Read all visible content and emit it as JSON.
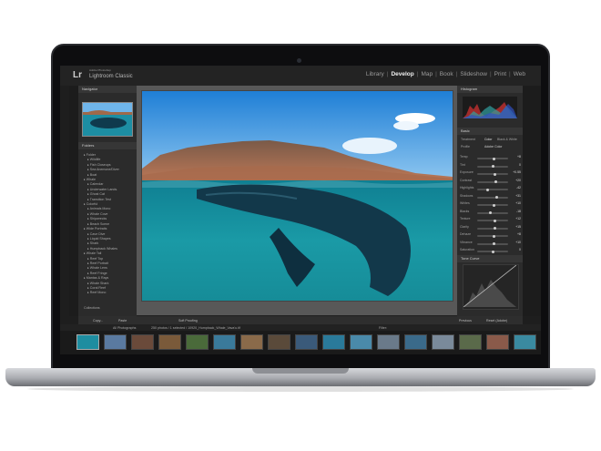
{
  "app": {
    "logo": "Lr",
    "vendor_line": "Adobe Photoshop",
    "product_line": "Lightroom Classic"
  },
  "modules": [
    "Library",
    "Develop",
    "Map",
    "Book",
    "Slideshow",
    "Print",
    "Web"
  ],
  "active_module": "Develop",
  "left_panel": {
    "navigator_title": "Navigator",
    "folders_title": "Folders",
    "tree_items": [
      "Folder",
      "Wildlife",
      "Fish Closeups",
      "Sea Anemone/Diver",
      "Boat",
      "Whale",
      "Calendar",
      "Underwater Lands.",
      "Ghost Cat",
      "Transition Test",
      "Colorful",
      "Animals Mono",
      "Whale Cove",
      "Shipwrecks",
      "Beach Scene",
      "Wide Portraits",
      "Cave Dive",
      "Liquid Shapes",
      "Shark",
      "Humpback Whales",
      "Whale Tail",
      "Reef Top",
      "Reef Portrait",
      "Whale Lens",
      "Reef Fringe",
      "Mantas & Rays",
      "Whale Shark",
      "Coral Reef",
      "Reef Mono"
    ],
    "collections_label": "Collections"
  },
  "right_panel": {
    "histogram_title": "Histogram",
    "basic_title": "Basic",
    "treatment_label": "Treatment",
    "color_label": "Color",
    "bw_label": "Black & White",
    "profile_label": "Profile",
    "profile_value": "Adobe Color",
    "sliders": [
      {
        "label": "Temp",
        "value": "+8",
        "pos": 0.55
      },
      {
        "label": "Tint",
        "value": "0",
        "pos": 0.5
      },
      {
        "label": "Exposure",
        "value": "+0.55",
        "pos": 0.58
      },
      {
        "label": "Contrast",
        "value": "+20",
        "pos": 0.6
      },
      {
        "label": "Highlights",
        "value": "-42",
        "pos": 0.35
      },
      {
        "label": "Shadows",
        "value": "+31",
        "pos": 0.64
      },
      {
        "label": "Whites",
        "value": "+10",
        "pos": 0.55
      },
      {
        "label": "Blacks",
        "value": "-18",
        "pos": 0.42
      },
      {
        "label": "Texture",
        "value": "+12",
        "pos": 0.56
      },
      {
        "label": "Clarity",
        "value": "+15",
        "pos": 0.57
      },
      {
        "label": "Dehaze",
        "value": "+8",
        "pos": 0.54
      },
      {
        "label": "Vibrance",
        "value": "+10",
        "pos": 0.55
      },
      {
        "label": "Saturation",
        "value": "0",
        "pos": 0.5
      }
    ],
    "tone_curve_title": "Tone Curve",
    "previous_button": "Previous",
    "reset_button": "Reset (Adobe)"
  },
  "toolbar": {
    "copy_button": "Copy...",
    "paste_button": "Paste",
    "soft_proofing": "Soft Proofing"
  },
  "filmstrip": {
    "source": "All Photographs",
    "photo_count": "250 photos / 1 selected / 10920_Humpback_Whale_Vava'u.tif",
    "filter_label": "Filter:",
    "thumb_count": 17,
    "selected_index": 0
  },
  "colors": {
    "accent": "#f0f0f0",
    "panel_bg": "#2b2b2b",
    "water": "#1f8aa0",
    "sky": "#5aa4e0"
  }
}
